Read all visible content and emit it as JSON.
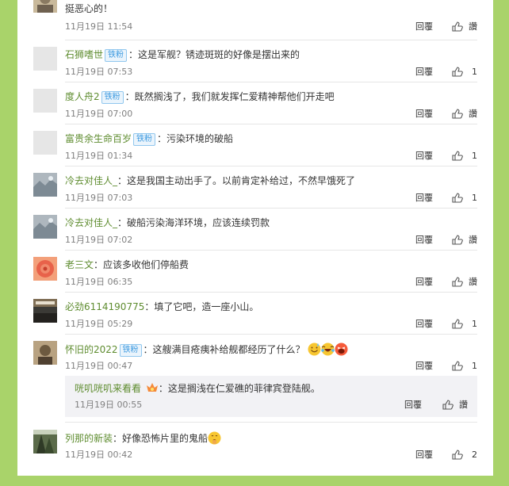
{
  "labels": {
    "reply": "回覆",
    "like_placeholder": "讚"
  },
  "colors": {
    "page_bg": "#a9d36a",
    "username": "#5e8c2f",
    "badge": "#3d9ae0"
  },
  "comments": [
    {
      "text": "挺恶心的！",
      "time": "11月19日 11:54",
      "likes": "讚",
      "avatar": "faded-portrait"
    },
    {
      "username": "石狮嗜世",
      "badge": "铁粉",
      "text": "：这是军舰？锈迹斑斑的好像是摆出来的",
      "time": "11月19日 07:53",
      "likes": "1",
      "avatar": "default"
    },
    {
      "username": "度人舟2",
      "badge": "铁粉",
      "text": "：既然搁浅了，我们就发挥仁爱精神帮他们开走吧",
      "time": "11月19日 07:00",
      "likes": "讚",
      "avatar": "default"
    },
    {
      "username": "富贵余生命百岁",
      "badge": "铁粉",
      "text": "：污染环境的破船",
      "time": "11月19日 01:34",
      "likes": "1",
      "avatar": "default"
    },
    {
      "username": "冷去对佳人_",
      "text": "：这是我国主动出手了。以前肯定补给过，不然早饿死了",
      "time": "11月19日 07:03",
      "likes": "1",
      "avatar": "grey-photo"
    },
    {
      "username": "冷去对佳人_",
      "text": "：破船污染海洋环境，应该连续罚款",
      "time": "11月19日 07:02",
      "likes": "讚",
      "avatar": "grey-photo"
    },
    {
      "username": "老三文",
      "text": "：应该多收他们停船费",
      "time": "11月19日 06:35",
      "likes": "讚",
      "avatar": "rose"
    },
    {
      "username": "必劲6114190775",
      "text": "：填了它吧，造一座小山。",
      "time": "11月19日 05:29",
      "likes": "1",
      "avatar": "dark-scene"
    },
    {
      "username": "怀旧的2022",
      "badge": "铁粉",
      "text": "：这艘满目疮痍补给舰都经历了什么？",
      "time": "11月19日 00:47",
      "likes": "1",
      "avatar": "portrait",
      "emoji": [
        "sweat-smile-emoji",
        "crying-laughing-emoji",
        "laughing-emoji"
      ]
    },
    {
      "username": "列那的新装",
      "text": "：好像恐怖片里的鬼船",
      "time": "11月19日 00:42",
      "likes": "2",
      "avatar": "forest",
      "emoji": [
        "shushing-emoji"
      ]
    }
  ],
  "subreply": {
    "username": "咣叽咣叽来看看",
    "text": "：这是搁浅在仁爱礁的菲律宾登陆舰。",
    "time": "11月19日 00:55",
    "likes": "讚"
  }
}
